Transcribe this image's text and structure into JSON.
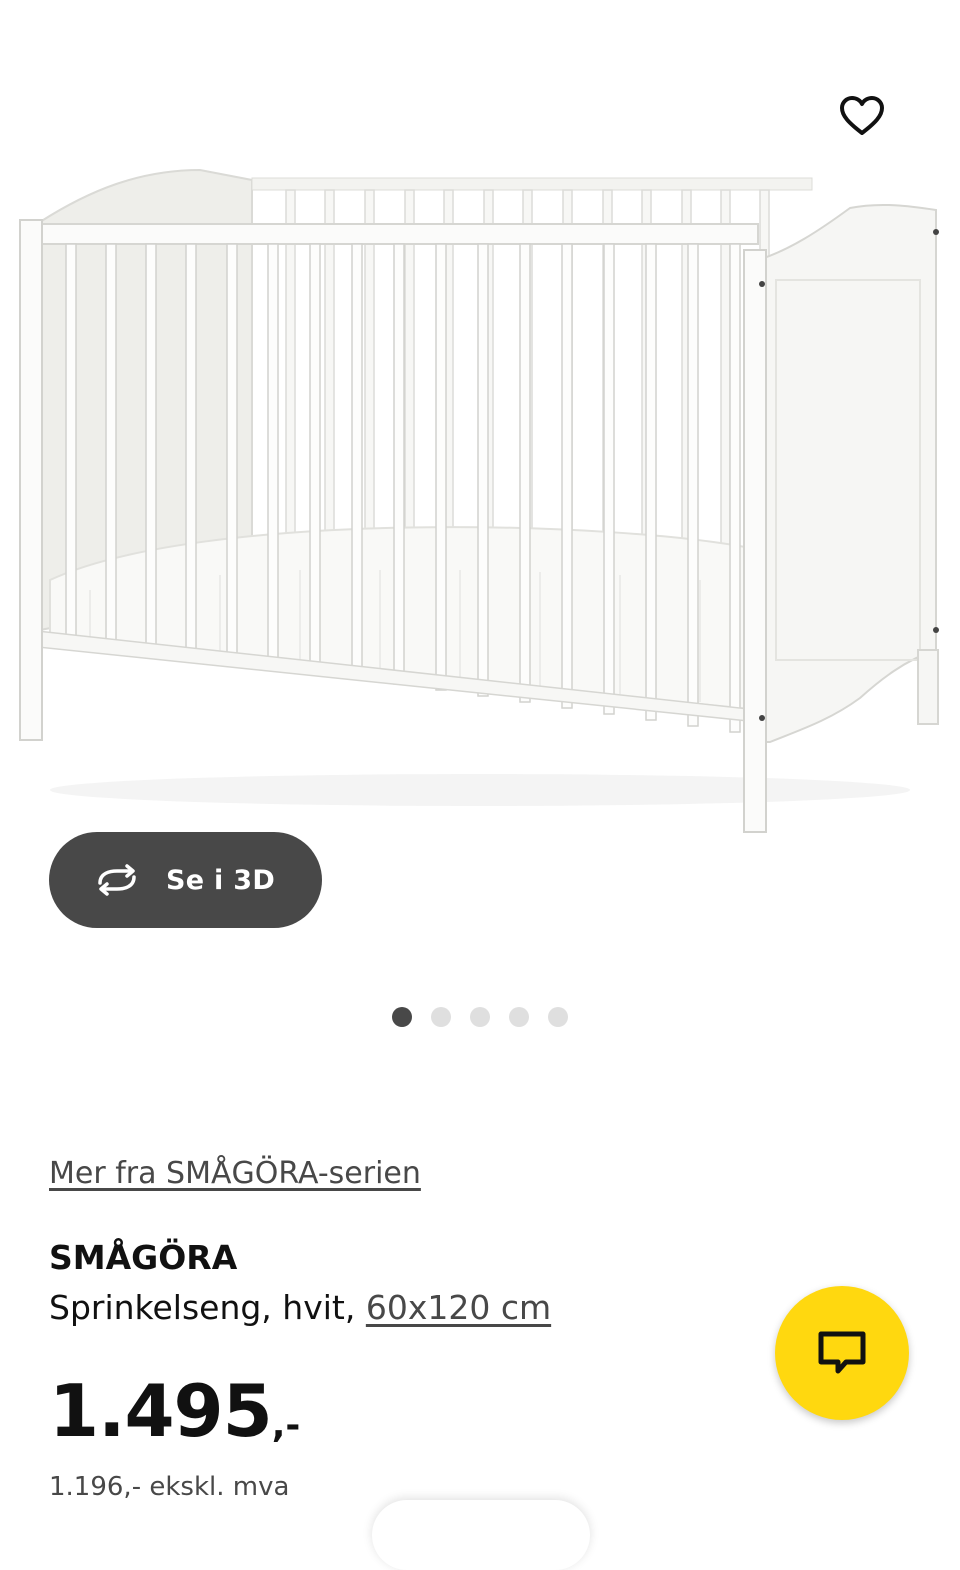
{
  "gallery": {
    "favorite_icon": "heart-outline-icon",
    "view_3d": {
      "icon": "rotate-arrows-icon",
      "label": "Se i 3D"
    },
    "dots": {
      "count": 5,
      "active_index": 0
    }
  },
  "product": {
    "series_link": "Mer fra SMÅGÖRA-serien",
    "name": "SMÅGÖRA",
    "description": "Sprinkelseng, hvit,",
    "size_link": "60x120 cm",
    "price_amount": "1.495",
    "price_suffix": ",-",
    "price_ex_vat": "1.196,- ekskl. mva"
  },
  "chat": {
    "icon": "chat-bubble-icon"
  },
  "colors": {
    "accent_yellow": "#ffd80f",
    "dark_button": "#484848",
    "dot_inactive": "#dfdfdf"
  }
}
